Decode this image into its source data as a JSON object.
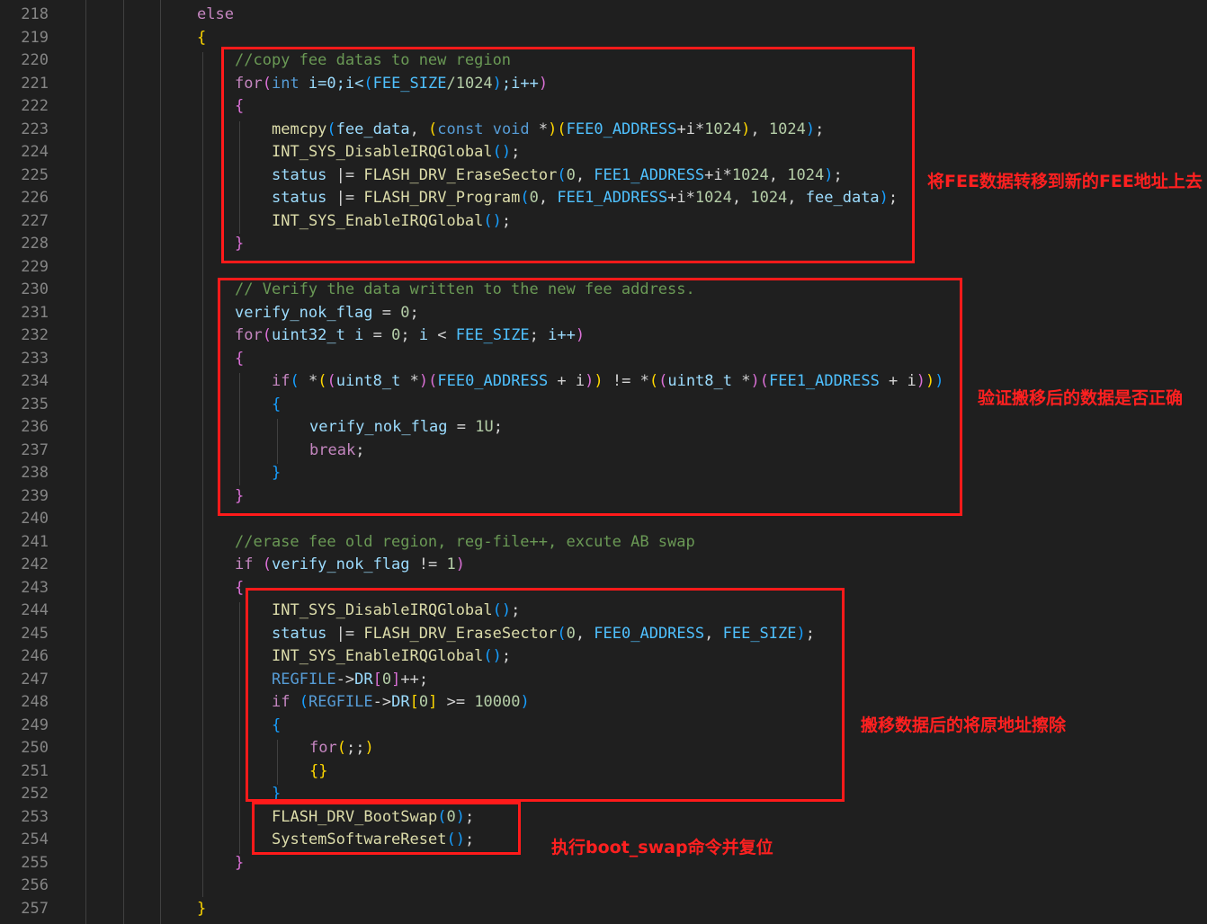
{
  "line_numbers": [
    "218",
    "219",
    "220",
    "221",
    "222",
    "223",
    "224",
    "225",
    "226",
    "227",
    "228",
    "229",
    "230",
    "231",
    "232",
    "233",
    "234",
    "235",
    "236",
    "237",
    "238",
    "239",
    "240",
    "241",
    "242",
    "243",
    "244",
    "245",
    "246",
    "247",
    "248",
    "249",
    "250",
    "251",
    "252",
    "253",
    "254",
    "255",
    "256",
    "257"
  ],
  "code": {
    "l218": {
      "else": "else"
    },
    "l219": {
      "brace": "{"
    },
    "l220": {
      "comment": "//copy fee datas to new region"
    },
    "l221": {
      "for": "for",
      "p_open": "(",
      "int": "int",
      "init": " i=0;i<",
      "p2_open": "(",
      "fee_size": "FEE_SIZE",
      "div": "/1024",
      "p2_close": ")",
      "inc": ";i++",
      "p_close": ")"
    },
    "l222": {
      "brace": "{"
    },
    "l223": {
      "memcpy": "memcpy",
      "p_open": "(",
      "fee_data": "fee_data",
      "sep1": ", ",
      "p2_open": "(",
      "const_void": "const void",
      "star": " *",
      "p2_close": ")",
      "p3_open": "(",
      "fee0": "FEE0_ADDRESS",
      "plus": "+i*",
      "n1024a": "1024",
      "p3_close": ")",
      "sep2": ", ",
      "n1024b": "1024",
      "p_close": ")",
      "semi": ";"
    },
    "l224": {
      "fn": "INT_SYS_DisableIRQGlobal",
      "parens": "()",
      "semi": ";"
    },
    "l225": {
      "status": "status",
      "op": " |= ",
      "fn": "FLASH_DRV_EraseSector",
      "p_open": "(",
      "zero": "0",
      "sep1": ", ",
      "fee1": "FEE1_ADDRESS",
      "plus": "+i*",
      "n1024a": "1024",
      "sep2": ", ",
      "n1024b": "1024",
      "p_close": ")",
      "semi": ";"
    },
    "l226": {
      "status": "status",
      "op": " |= ",
      "fn": "FLASH_DRV_Program",
      "p_open": "(",
      "zero": "0",
      "sep1": ", ",
      "fee1": "FEE1_ADDRESS",
      "plus": "+i*",
      "n1024a": "1024",
      "sep2": ", ",
      "n1024b": "1024",
      "sep3": ", ",
      "fee_data": "fee_data",
      "p_close": ")",
      "semi": ";"
    },
    "l227": {
      "fn": "INT_SYS_EnableIRQGlobal",
      "parens": "()",
      "semi": ";"
    },
    "l228": {
      "brace": "}"
    },
    "l230": {
      "comment": "// Verify the data written to the new fee address."
    },
    "l231": {
      "var": "verify_nok_flag",
      "op": " = ",
      "zero": "0",
      "semi": ";"
    },
    "l232": {
      "for": "for",
      "p_open": "(",
      "type": "uint32_t",
      "sp": " ",
      "i1": "i",
      "eq": " = ",
      "zero": "0",
      "semi1": "; ",
      "i2": "i",
      "lt": " < ",
      "fee_size": "FEE_SIZE",
      "semi2": "; ",
      "inc": "i++",
      "p_close": ")"
    },
    "l233": {
      "brace": "{"
    },
    "l234": {
      "if": "if",
      "p_open": "(",
      "deref1": " *",
      "p2a_open": "(",
      "p3a_open": "(",
      "type1": "uint8_t",
      "star1": " *",
      "p3a_close": ")",
      "p3b_open": "(",
      "fee0": "FEE0_ADDRESS",
      "plus1": " + i",
      "p3b_close": ")",
      "p2a_close": ")",
      "ne": " != ",
      "deref2": "*",
      "p2b_open": "(",
      "p3c_open": "(",
      "type2": "uint8_t",
      "star2": " *",
      "p3c_close": ")",
      "p3d_open": "(",
      "fee1": "FEE1_ADDRESS",
      "plus2": " + i",
      "p3d_close": ")",
      "p2b_close": ")",
      "p_close": ")"
    },
    "l235": {
      "brace": "{"
    },
    "l236": {
      "var": "verify_nok_flag",
      "op": " = ",
      "val": "1U",
      "semi": ";"
    },
    "l237": {
      "brk": "break",
      "semi": ";"
    },
    "l238": {
      "brace": "}"
    },
    "l239": {
      "brace": "}"
    },
    "l241": {
      "comment": "//erase fee old region, reg-file++, excute AB swap"
    },
    "l242": {
      "if": "if",
      "sp": " ",
      "p_open": "(",
      "var": "verify_nok_flag",
      "op": " != ",
      "one": "1",
      "p_close": ")"
    },
    "l243": {
      "brace": "{"
    },
    "l244": {
      "fn": "INT_SYS_DisableIRQGlobal",
      "parens": "()",
      "semi": ";"
    },
    "l245": {
      "status": "status",
      "op": " |= ",
      "fn": "FLASH_DRV_EraseSector",
      "p_open": "(",
      "zero": "0",
      "sep1": ", ",
      "fee0": "FEE0_ADDRESS",
      "sep2": ", ",
      "fee_size": "FEE_SIZE",
      "p_close": ")",
      "semi": ";"
    },
    "l246": {
      "fn": "INT_SYS_EnableIRQGlobal",
      "parens": "()",
      "semi": ";"
    },
    "l247": {
      "reg": "REGFILE",
      "arrow": "->",
      "dr": "DR",
      "b_open": "[",
      "zero": "0",
      "b_close": "]",
      "inc": "++;"
    },
    "l248": {
      "if": "if",
      "sp": " ",
      "p_open": "(",
      "reg": "REGFILE",
      "arrow": "->",
      "dr": "DR",
      "b_open": "[",
      "zero": "0",
      "b_close": "]",
      "op": " >= ",
      "num": "10000",
      "p_close": ")"
    },
    "l249": {
      "brace": "{"
    },
    "l250": {
      "for": "for",
      "p_open": "(",
      "body": ";;",
      "p_close": ")"
    },
    "l251": {
      "braces": "{}"
    },
    "l252": {
      "brace": "}"
    },
    "l253": {
      "fn": "FLASH_DRV_BootSwap",
      "p_open": "(",
      "zero": "0",
      "p_close": ")",
      "semi": ";"
    },
    "l254": {
      "fn": "SystemSoftwareReset",
      "parens": "()",
      "semi": ";"
    },
    "l255": {
      "brace": "}"
    },
    "l257": {
      "brace": "}"
    }
  },
  "annotations": {
    "copy": "将FEE数据转移到新的FEE地址上去",
    "verify": "验证搬移后的数据是否正确",
    "erase": "搬移数据后的将原地址擦除",
    "swap": "执行boot_swap命令并复位"
  },
  "colors": {
    "background": "#1f1f1f",
    "annotation": "#ff2020",
    "comment": "#6a9955",
    "keyword": "#c586c0",
    "type": "#569cd6",
    "function": "#dcdcaa",
    "variable": "#9cdcfe",
    "macro": "#4fc1ff",
    "number": "#b5cea8"
  }
}
